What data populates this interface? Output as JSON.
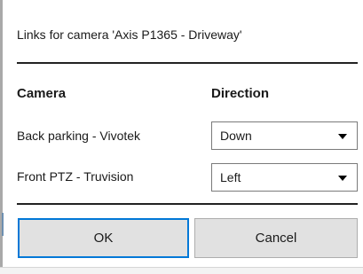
{
  "dialog": {
    "title": "Links for camera 'Axis P1365 - Driveway'"
  },
  "columns": {
    "camera": "Camera",
    "direction": "Direction"
  },
  "links": [
    {
      "camera": "Back parking - Vivotek",
      "direction": "Down"
    },
    {
      "camera": "Front PTZ - Truvision",
      "direction": "Left"
    }
  ],
  "buttons": {
    "ok": "OK",
    "cancel": "Cancel"
  },
  "icons": {
    "dropdown": "chevron-down-icon"
  },
  "colors": {
    "default_button_border": "#0078d7",
    "button_face": "#e1e1e1"
  }
}
